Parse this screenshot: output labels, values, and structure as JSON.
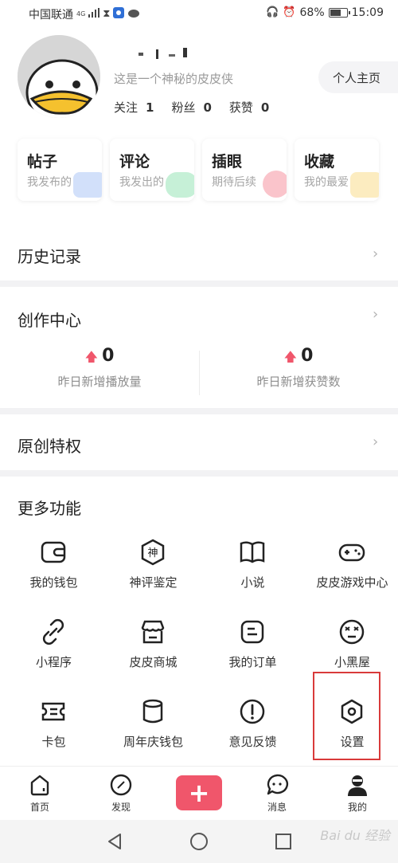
{
  "status_bar": {
    "carrier": "中国联通",
    "network": "4G",
    "battery": "68%",
    "time": "15:09",
    "battery_level": 0.68
  },
  "profile": {
    "motto": "这是一个神秘的皮皮侠",
    "home_button": "个人主页",
    "stats": [
      {
        "label": "关注",
        "value": "1"
      },
      {
        "label": "粉丝",
        "value": "0"
      },
      {
        "label": "获赞",
        "value": "0"
      }
    ]
  },
  "cards": [
    {
      "title": "帖子",
      "subtitle": "我发布的",
      "color": "#7ea7f2"
    },
    {
      "title": "评论",
      "subtitle": "我发出的",
      "color": "#5bd38c"
    },
    {
      "title": "插眼",
      "subtitle": "期待后续",
      "color": "#f0566b"
    },
    {
      "title": "收藏",
      "subtitle": "我的最爱",
      "color": "#f7c94a"
    }
  ],
  "history": {
    "title": "历史记录"
  },
  "creator": {
    "title": "创作中心",
    "metrics": [
      {
        "value": "0",
        "label": "昨日新增播放量"
      },
      {
        "value": "0",
        "label": "昨日新增获赞数"
      }
    ]
  },
  "original": {
    "title": "原创特权"
  },
  "more": {
    "title": "更多功能",
    "items": [
      {
        "label": "我的钱包",
        "icon": "wallet-icon"
      },
      {
        "label": "神评鉴定",
        "icon": "shen-badge-icon",
        "glyph": "神"
      },
      {
        "label": "小说",
        "icon": "book-icon"
      },
      {
        "label": "皮皮游戏中心",
        "icon": "gamepad-icon"
      },
      {
        "label": "小程序",
        "icon": "link-icon"
      },
      {
        "label": "皮皮商城",
        "icon": "store-icon"
      },
      {
        "label": "我的订单",
        "icon": "order-icon"
      },
      {
        "label": "小黑屋",
        "icon": "dizzy-face-icon"
      },
      {
        "label": "卡包",
        "icon": "card-holder-icon"
      },
      {
        "label": "周年庆钱包",
        "icon": "cylinder-icon"
      },
      {
        "label": "意见反馈",
        "icon": "feedback-icon"
      },
      {
        "label": "设置",
        "icon": "settings-hexagon-icon"
      }
    ]
  },
  "tabbar": {
    "items": [
      {
        "label": "首页"
      },
      {
        "label": "发现"
      },
      {
        "label": "消息"
      },
      {
        "label": "我的"
      }
    ],
    "accent": "#f0566b"
  },
  "watermark": "Bai du 经验"
}
